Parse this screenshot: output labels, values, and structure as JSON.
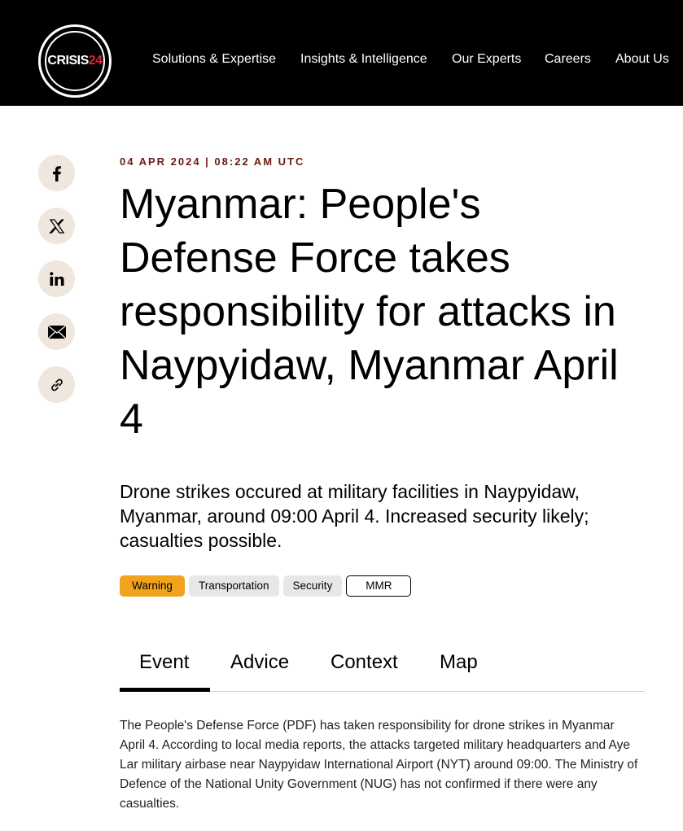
{
  "header": {
    "logo_text": "CRISIS",
    "logo_num": "24",
    "nav": [
      {
        "label": "Solutions & Expertise"
      },
      {
        "label": "Insights & Intelligence"
      },
      {
        "label": "Our Experts"
      },
      {
        "label": "Careers"
      },
      {
        "label": "About Us"
      }
    ]
  },
  "share": [
    {
      "icon": "facebook-icon"
    },
    {
      "icon": "x-icon"
    },
    {
      "icon": "linkedin-icon"
    },
    {
      "icon": "email-icon"
    },
    {
      "icon": "link-icon"
    }
  ],
  "article": {
    "meta": "04 APR 2024 | 08:22 AM UTC",
    "title": "Myanmar: People's Defense Force takes responsibility for attacks in Naypyidaw, Myanmar April 4",
    "summary": "Drone strikes occured at military facilities in Naypyidaw, Myanmar, around 09:00 April 4. Increased security likely; casualties possible.",
    "tags": [
      {
        "label": "Warning",
        "style": "warning"
      },
      {
        "label": "Transportation",
        "style": "grey"
      },
      {
        "label": "Security",
        "style": "grey"
      },
      {
        "label": "MMR",
        "style": "outline"
      }
    ],
    "tabs": [
      {
        "label": "Event",
        "active": true
      },
      {
        "label": "Advice"
      },
      {
        "label": "Context"
      },
      {
        "label": "Map"
      }
    ],
    "body": "The People's Defense Force (PDF) has taken responsibility for drone strikes in Myanmar April 4. According to local media reports, the attacks targeted military headquarters and Aye Lar military airbase near Naypyidaw International Airport (NYT) around 09:00. The Ministry of Defence of the National Unity Government (NUG) has not confirmed if there were any casualties."
  },
  "colors": {
    "header_bg": "#000000",
    "brand_red": "#e8212f",
    "meta_color": "#6b1a14",
    "warning_tag": "#f0a31b",
    "share_bg": "#efe6de"
  }
}
